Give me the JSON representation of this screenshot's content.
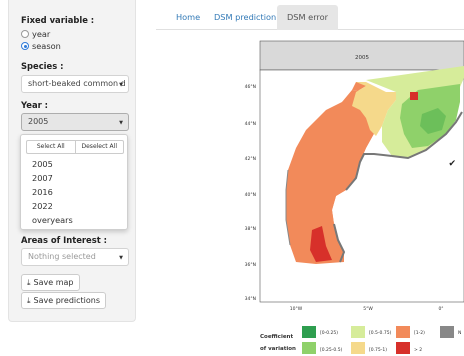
{
  "sidebar": {
    "fixed_variable_label": "Fixed variable :",
    "radio_year": "year",
    "radio_season": "season",
    "species_label": "Species :",
    "species_value": "short-beaked common d",
    "year_label": "Year :",
    "year_value": "2005",
    "year_dropdown": {
      "select_all": "Select All",
      "deselect_all": "Deselect All",
      "options": [
        "2005",
        "2007",
        "2016",
        "2022",
        "overyears"
      ],
      "check": "✔"
    },
    "areas_label": "Areas of Interest :",
    "areas_placeholder": "Nothing selected",
    "save_map": "Save map",
    "save_predictions": "Save predictions"
  },
  "tabs": [
    "Home",
    "DSM prediction",
    "DSM error"
  ],
  "map": {
    "panel_title": "2005",
    "lat_labels": [
      "46°N",
      "44°N",
      "42°N",
      "40°N",
      "38°N",
      "36°N",
      "34°N"
    ],
    "lon_labels": [
      "10°W",
      "5°W",
      "0°"
    ],
    "legend_title_1": "Coefficient",
    "legend_title_2": "of variation",
    "legend_items": [
      {
        "label": "[0-0.25)",
        "color": "#2e9e4f"
      },
      {
        "label": "[0.25-0.5)",
        "color": "#8fd16a"
      },
      {
        "label": "[0.5-0.75)",
        "color": "#d6ec9a"
      },
      {
        "label": "[0.75-1)",
        "color": "#f5d98b"
      },
      {
        "label": "[1-2)",
        "color": "#f28a5a"
      },
      {
        "label": "> 2",
        "color": "#d7302a"
      },
      {
        "label": "N",
        "color": "#888888"
      }
    ]
  }
}
